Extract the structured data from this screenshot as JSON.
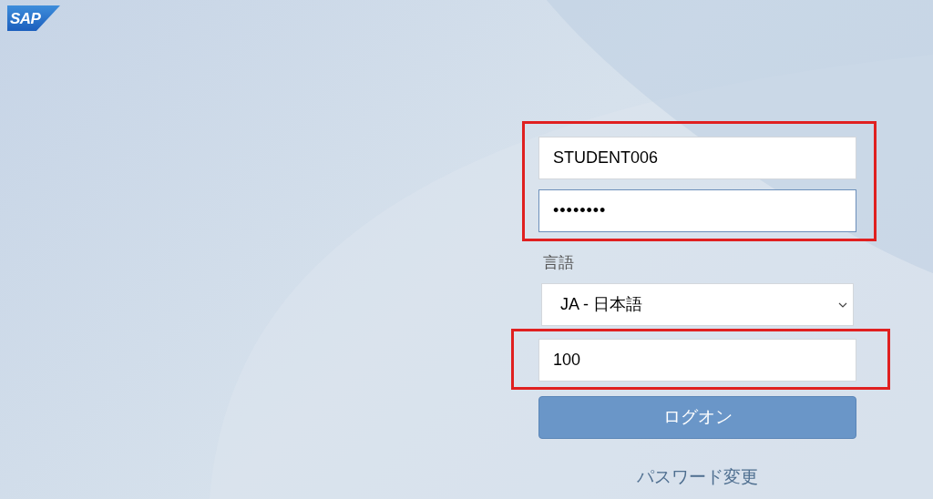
{
  "logo": {
    "text": "SAP"
  },
  "groups": [
    {
      "highlighted": true,
      "fields": [
        {
          "kind": "text",
          "value": "STUDENT006",
          "focused": false
        },
        {
          "kind": "password",
          "value": "••••••••",
          "focused": true
        }
      ]
    },
    {
      "highlighted": false,
      "fields": [
        {
          "kind": "label",
          "text": "言語"
        },
        {
          "kind": "select",
          "value": "JA - 日本語",
          "focused": false
        }
      ]
    },
    {
      "highlighted": true,
      "fields": [
        {
          "kind": "text",
          "value": "100",
          "focused": false
        }
      ]
    }
  ],
  "logon_button": {
    "label": "ログオン"
  },
  "change_password_link": {
    "label": "パスワード変更"
  }
}
